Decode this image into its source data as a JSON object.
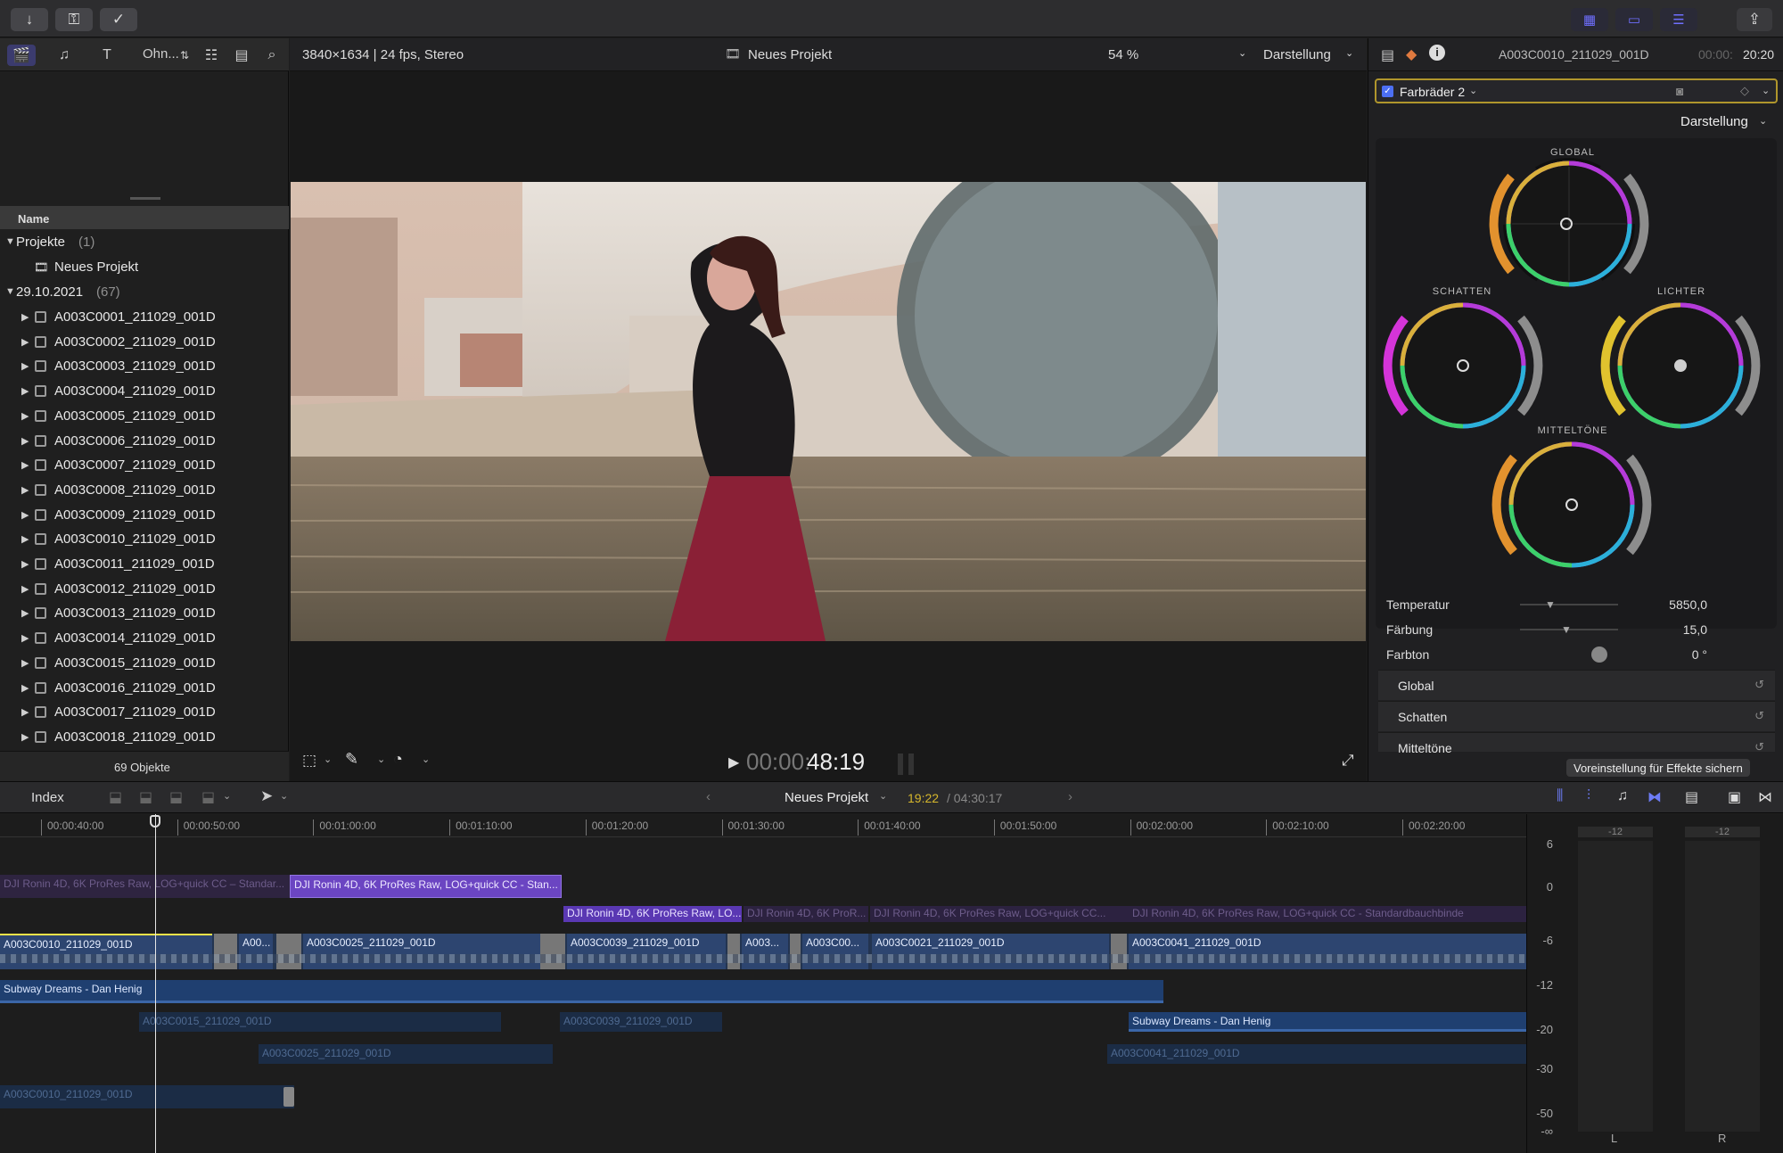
{
  "toolbar": {
    "left_icons": [
      "import-icon",
      "key-icon",
      "check-circle-icon"
    ],
    "right_icons": [
      "grid-icon",
      "clip-icon",
      "sliders-icon"
    ],
    "share_icon": "share-icon"
  },
  "library": {
    "partial_label": "Ohn...",
    "column_name": "Name",
    "projects_group": "Projekte",
    "projects_count": "(1)",
    "project_item": "Neues Projekt",
    "event_group": "29.10.2021",
    "event_count": "(67)",
    "clips": [
      "A003C0001_211029_001D",
      "A003C0002_211029_001D",
      "A003C0003_211029_001D",
      "A003C0004_211029_001D",
      "A003C0005_211029_001D",
      "A003C0006_211029_001D",
      "A003C0007_211029_001D",
      "A003C0008_211029_001D",
      "A003C0009_211029_001D",
      "A003C0010_211029_001D",
      "A003C0011_211029_001D",
      "A003C0012_211029_001D",
      "A003C0013_211029_001D",
      "A003C0014_211029_001D",
      "A003C0015_211029_001D",
      "A003C0016_211029_001D",
      "A003C0017_211029_001D",
      "A003C0018_211029_001D"
    ],
    "footer": "69 Objekte"
  },
  "viewer": {
    "format": "3840×1634 | 24 fps, Stereo",
    "project_title": "Neues Projekt",
    "zoom": "54 %",
    "display": "Darstellung",
    "timecode_dim": "00:00:",
    "timecode": "48:19"
  },
  "inspector": {
    "clip_name": "A003C0010_211029_001D",
    "clip_time_dim": "00:00:",
    "clip_time": "20:20",
    "effect": "Farbräder 2",
    "display": "Darstellung",
    "wheels": {
      "global": "GLOBAL",
      "shadows": "SCHATTEN",
      "highlights": "LICHTER",
      "midtones": "MITTELTÖNE"
    },
    "params": [
      {
        "label": "Temperatur",
        "value": "5850,0"
      },
      {
        "label": "Färbung",
        "value": "15,0"
      },
      {
        "label": "Farbton",
        "value": "0 °"
      }
    ],
    "sections": [
      "Global",
      "Schatten",
      "Mitteltöne"
    ],
    "save_preset": "Voreinstellung für Effekte sichern"
  },
  "timeline": {
    "index": "Index",
    "project": "Neues Projekt",
    "time_current": "19:22",
    "time_total": "/ 04:30:17",
    "ruler": [
      "00:00:40:00",
      "00:00:50:00",
      "00:01:00:00",
      "00:01:10:00",
      "00:01:20:00",
      "00:01:30:00",
      "00:01:40:00",
      "00:01:50:00",
      "00:02:00:00",
      "00:02:10:00",
      "00:02:20:00"
    ],
    "effect_clips": [
      "DJI Ronin 4D, 6K ProRes Raw, LOG+quick CC – Standar...",
      "DJI Ronin 4D, 6K ProRes Raw, LOG+quick CC  - Stan...",
      "DJI Ronin 4D, 6K ProRes Raw, LO...",
      "DJI Ronin 4D, 6K ProR...",
      "DJI Ronin 4D, 6K ProRes Raw, LOG+quick CC...",
      "DJI Ronin 4D, 6K ProRes Raw, LOG+quick CC - Standardbauchbinde"
    ],
    "video_clips": [
      "A003C0010_211029_001D",
      "A00...",
      "A003C0025_211029_001D",
      "A003C0039_211029_001D",
      "A003...",
      "A003C00...",
      "A003C0021_211029_001D",
      "A003C0041_211029_001D"
    ],
    "audio_main": "Subway Dreams - Dan Henig",
    "audio_clips": [
      "A003C0015_211029_001D",
      "A003C0039_211029_001D",
      "Subway Dreams - Dan Henig",
      "A003C0025_211029_001D",
      "A003C0041_211029_001D",
      "A003C0010_211029_001D"
    ],
    "meter_peak_l": "-12",
    "meter_peak_r": "-12",
    "meter_scale": [
      "6",
      "0",
      "-6",
      "-12",
      "-20",
      "-30",
      "-50",
      "-∞"
    ],
    "meter_l": "L",
    "meter_r": "R"
  }
}
